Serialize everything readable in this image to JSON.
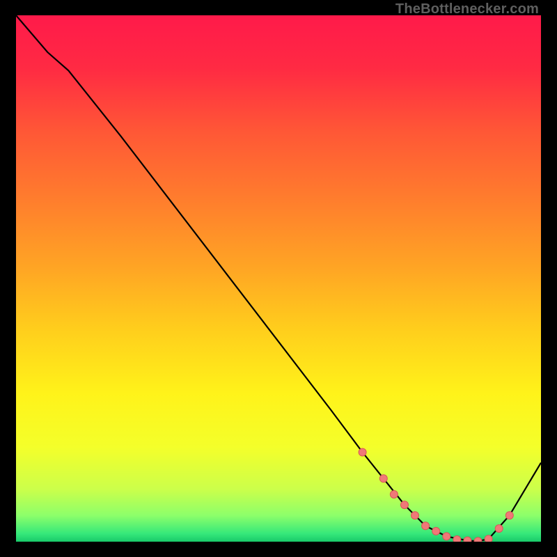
{
  "attribution": "TheBottlenecker.com",
  "colors": {
    "line": "#000000",
    "dot_fill": "#f07878",
    "dot_stroke": "#d85858"
  },
  "chart_data": {
    "type": "line",
    "title": "",
    "xlabel": "",
    "ylabel": "",
    "xlim": [
      0,
      100
    ],
    "ylim": [
      0,
      100
    ],
    "x": [
      0,
      6,
      10,
      20,
      30,
      40,
      50,
      60,
      66,
      70,
      74,
      78,
      82,
      86,
      88,
      90,
      94,
      100
    ],
    "y": [
      100,
      93,
      89.5,
      77,
      64,
      51,
      38,
      25,
      17,
      12,
      7,
      3,
      1,
      0.2,
      0.1,
      0.5,
      5,
      15
    ],
    "series": [
      {
        "name": "curve",
        "x": [
          0,
          6,
          10,
          20,
          30,
          40,
          50,
          60,
          66,
          70,
          74,
          78,
          82,
          86,
          88,
          90,
          94,
          100
        ],
        "y": [
          100,
          93,
          89.5,
          77,
          64,
          51,
          38,
          25,
          17,
          12,
          7,
          3,
          1,
          0.2,
          0.1,
          0.5,
          5,
          15
        ]
      },
      {
        "name": "highlight-dots",
        "x": [
          66,
          70,
          72,
          74,
          76,
          78,
          80,
          82,
          84,
          86,
          88,
          90,
          92,
          94
        ],
        "y": [
          17,
          12,
          9,
          7,
          5,
          3,
          2,
          1,
          0.4,
          0.2,
          0.1,
          0.5,
          2.5,
          5
        ]
      }
    ],
    "gradient_stops": [
      {
        "offset": 0.0,
        "color": "#ff1a4a"
      },
      {
        "offset": 0.1,
        "color": "#ff2a43"
      },
      {
        "offset": 0.22,
        "color": "#ff5736"
      },
      {
        "offset": 0.35,
        "color": "#ff7d2d"
      },
      {
        "offset": 0.48,
        "color": "#ffa524"
      },
      {
        "offset": 0.6,
        "color": "#ffcf1c"
      },
      {
        "offset": 0.72,
        "color": "#fff31a"
      },
      {
        "offset": 0.82,
        "color": "#f4ff2a"
      },
      {
        "offset": 0.9,
        "color": "#ccff4a"
      },
      {
        "offset": 0.95,
        "color": "#8dff6a"
      },
      {
        "offset": 0.985,
        "color": "#35e87a"
      },
      {
        "offset": 1.0,
        "color": "#19c96a"
      }
    ]
  }
}
